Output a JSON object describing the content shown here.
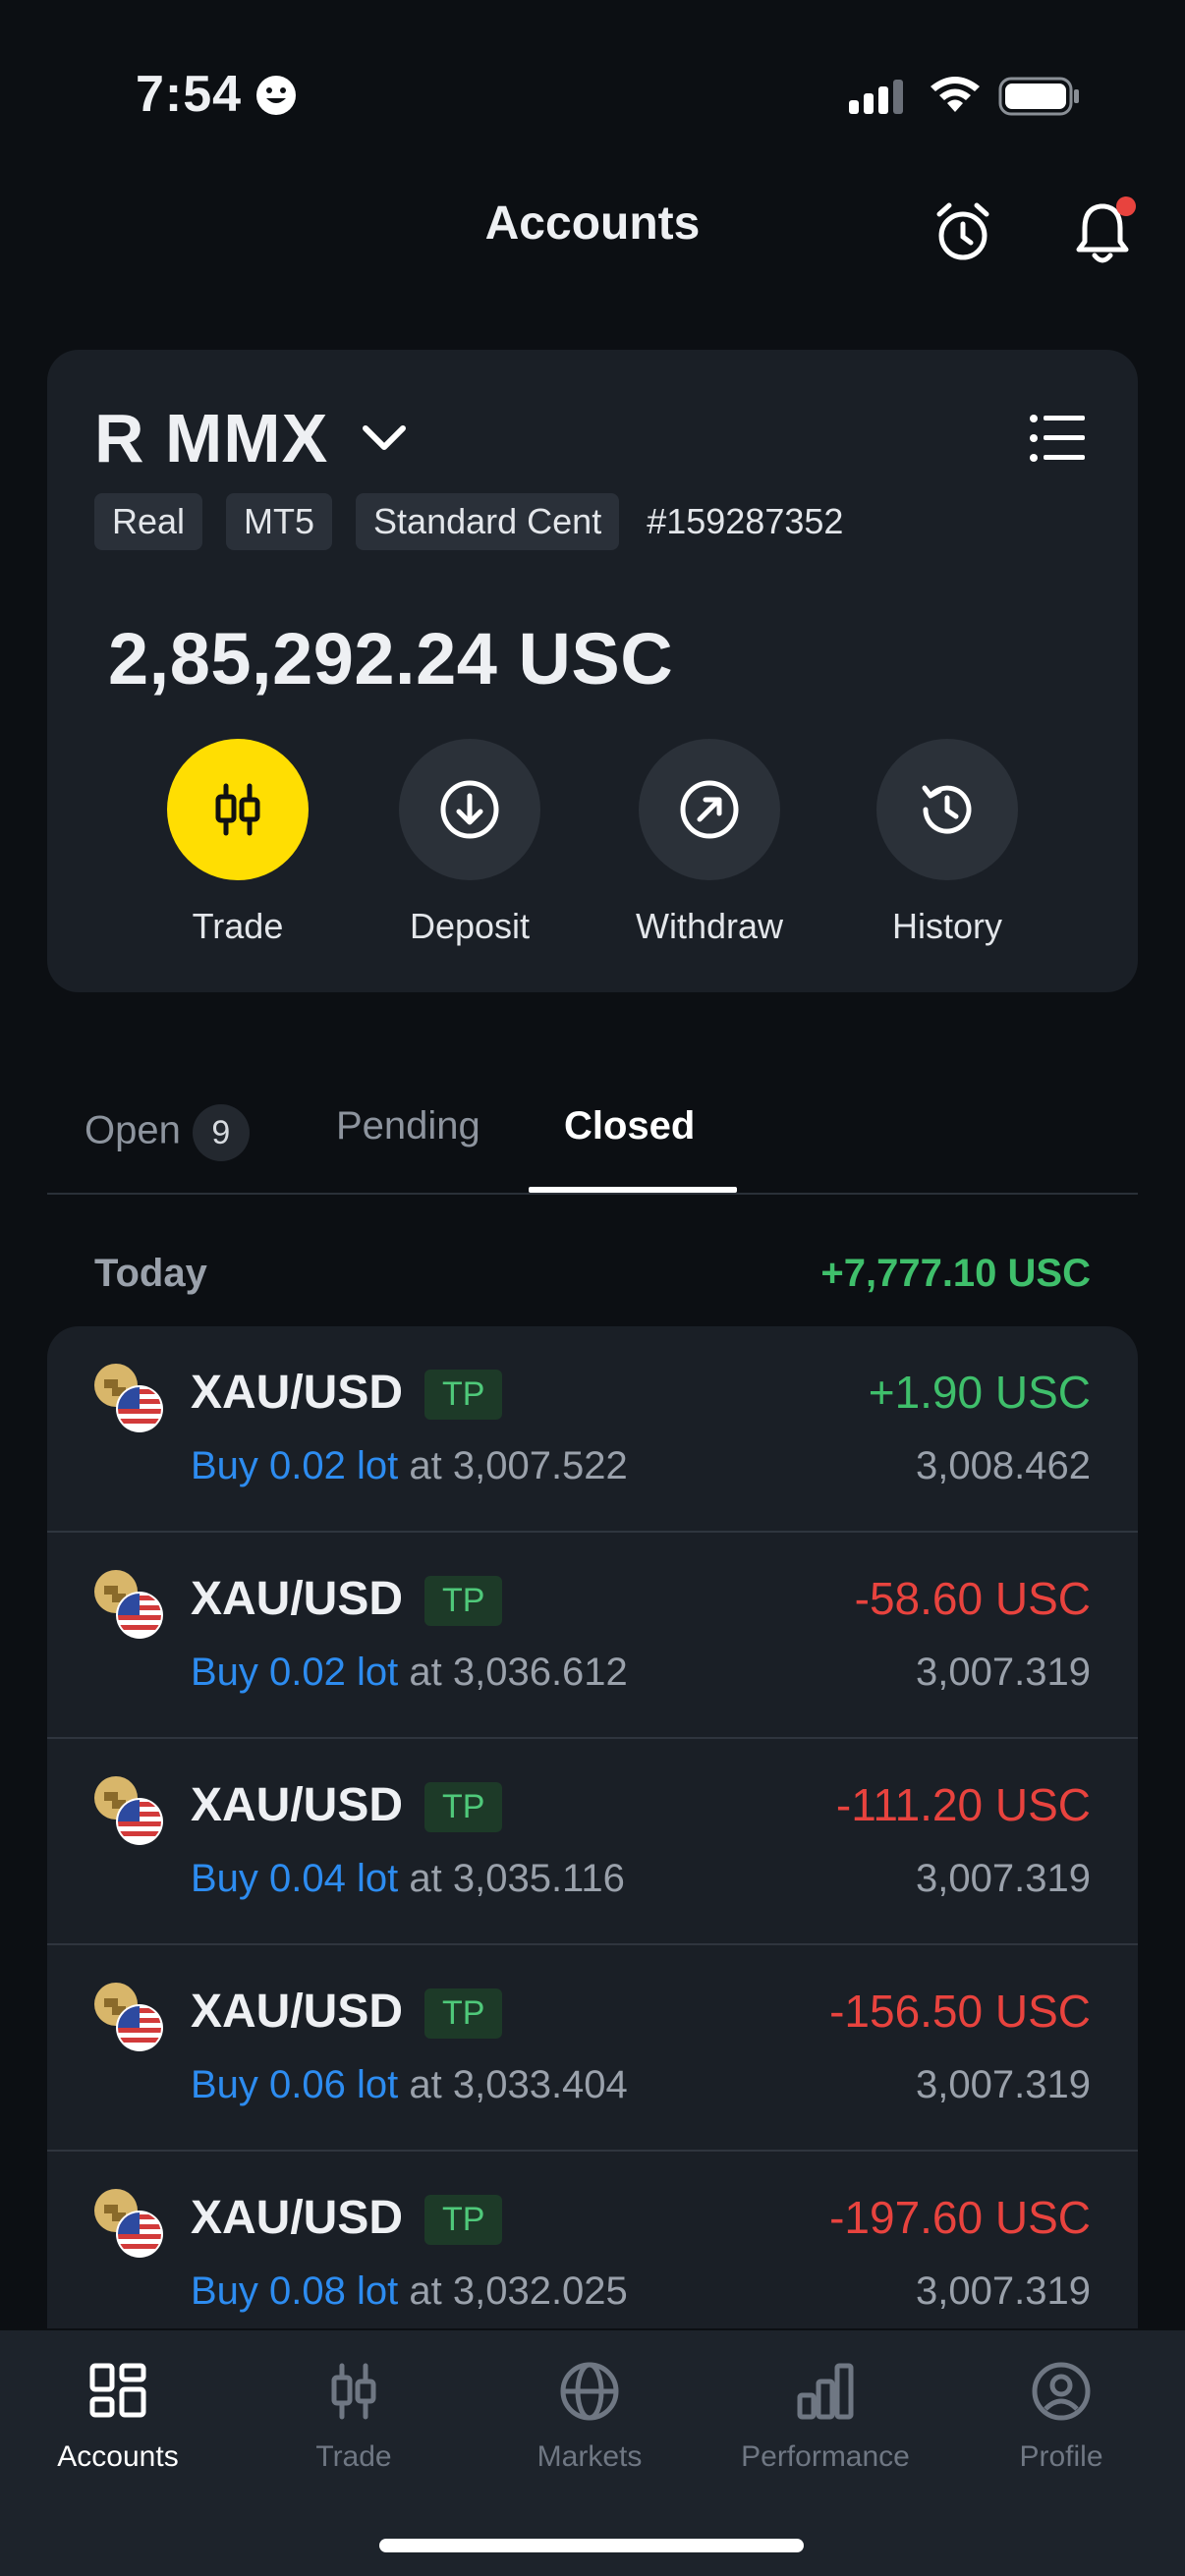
{
  "status_bar": {
    "time": "7:54"
  },
  "header": {
    "title": "Accounts"
  },
  "account": {
    "name": "R MMX",
    "tags": [
      "Real",
      "MT5",
      "Standard Cent"
    ],
    "id": "#159287352",
    "balance": "2,85,292.24 USC",
    "actions": [
      {
        "label": "Trade",
        "icon": "candlestick-icon"
      },
      {
        "label": "Deposit",
        "icon": "download-icon"
      },
      {
        "label": "Withdraw",
        "icon": "arrow-up-right-icon"
      },
      {
        "label": "History",
        "icon": "history-icon"
      }
    ]
  },
  "tabs": [
    {
      "label": "Open",
      "badge": "9"
    },
    {
      "label": "Pending"
    },
    {
      "label": "Closed",
      "active": true
    }
  ],
  "summary": {
    "label": "Today",
    "total": "+7,777.10 USC"
  },
  "trades": [
    {
      "symbol": "XAU/USD",
      "tag": "TP",
      "side": "Buy 0.02 lot",
      "open": "at 3,007.522",
      "pnl": "+1.90 USC",
      "close": "3,008.462"
    },
    {
      "symbol": "XAU/USD",
      "tag": "TP",
      "side": "Buy 0.02 lot",
      "open": "at 3,036.612",
      "pnl": "-58.60 USC",
      "close": "3,007.319"
    },
    {
      "symbol": "XAU/USD",
      "tag": "TP",
      "side": "Buy 0.04 lot",
      "open": "at 3,035.116",
      "pnl": "-111.20 USC",
      "close": "3,007.319"
    },
    {
      "symbol": "XAU/USD",
      "tag": "TP",
      "side": "Buy 0.06 lot",
      "open": "at 3,033.404",
      "pnl": "-156.50 USC",
      "close": "3,007.319"
    },
    {
      "symbol": "XAU/USD",
      "tag": "TP",
      "side": "Buy 0.08 lot",
      "open": "at 3,032.025",
      "pnl": "-197.60 USC",
      "close": "3,007.319"
    }
  ],
  "nav": [
    {
      "label": "Accounts",
      "icon": "grid-icon",
      "active": true
    },
    {
      "label": "Trade",
      "icon": "candlestick-icon"
    },
    {
      "label": "Markets",
      "icon": "globe-icon"
    },
    {
      "label": "Performance",
      "icon": "bar-chart-icon"
    },
    {
      "label": "Profile",
      "icon": "user-icon"
    }
  ],
  "colors": {
    "background": "#0c0f13",
    "card": "#1a1f26",
    "accent_yellow": "#ffde02",
    "positive": "#3fbf6b",
    "negative": "#e8433e",
    "link_blue": "#2d8cf0"
  }
}
